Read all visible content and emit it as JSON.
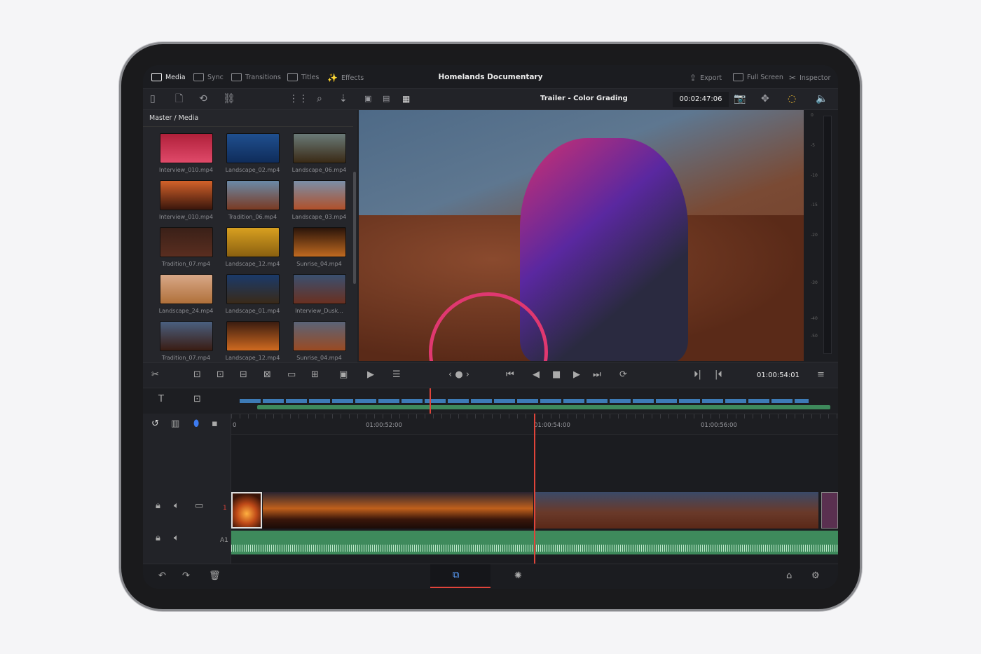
{
  "topbar": {
    "tabs": [
      {
        "label": "Media",
        "icon": "media-icon",
        "active": true
      },
      {
        "label": "Sync",
        "icon": "sync-icon"
      },
      {
        "label": "Transitions",
        "icon": "transitions-icon"
      },
      {
        "label": "Titles",
        "icon": "titles-icon"
      },
      {
        "label": "Effects",
        "icon": "effects-wand-icon"
      }
    ],
    "project_title": "Homelands Documentary",
    "right": [
      {
        "label": "Export",
        "icon": "export-icon"
      },
      {
        "label": "Full Screen",
        "icon": "fullscreen-icon"
      },
      {
        "label": "Inspector",
        "icon": "inspector-icon"
      }
    ]
  },
  "viewer": {
    "timeline_name": "Trailer - Color Grading",
    "source_timecode": "00:02:47:06"
  },
  "media": {
    "breadcrumb": "Master / Media",
    "clips": [
      {
        "name": "Interview_010.mp4",
        "colors": [
          "#b0203a",
          "#e04a6a"
        ]
      },
      {
        "name": "Landscape_02.mp4",
        "colors": [
          "#1f4f8f",
          "#0f2c5a"
        ]
      },
      {
        "name": "Landscape_06.mp4",
        "colors": [
          "#6a7a78",
          "#3a2a15"
        ]
      },
      {
        "name": "Interview_010.mp4",
        "colors": [
          "#d4622a",
          "#3a160c"
        ]
      },
      {
        "name": "Tradition_06.mp4",
        "colors": [
          "#6a8aa8",
          "#7a3a22"
        ]
      },
      {
        "name": "Landscape_03.mp4",
        "colors": [
          "#7a8fa8",
          "#b0502a"
        ]
      },
      {
        "name": "Tradition_07.mp4",
        "colors": [
          "#3a2018",
          "#5a2e20"
        ]
      },
      {
        "name": "Landscape_12.mp4",
        "colors": [
          "#d8a020",
          "#8a6010"
        ]
      },
      {
        "name": "Sunrise_04.mp4",
        "colors": [
          "#2a140a",
          "#c06a20"
        ]
      },
      {
        "name": "Landscape_24.mp4",
        "colors": [
          "#d8a888",
          "#b0703a"
        ]
      },
      {
        "name": "Landscape_01.mp4",
        "colors": [
          "#1a3a6a",
          "#3a2a18"
        ]
      },
      {
        "name": "Interview_Dusk...",
        "colors": [
          "#3a5070",
          "#6a3020"
        ]
      },
      {
        "name": "Tradition_07.mp4",
        "colors": [
          "#4a6080",
          "#3a1c12"
        ]
      },
      {
        "name": "Landscape_12.mp4",
        "colors": [
          "#3a1c10",
          "#d06a20"
        ]
      },
      {
        "name": "Sunrise_04.mp4",
        "colors": [
          "#5a6478",
          "#9a4a22"
        ]
      }
    ]
  },
  "meter": {
    "scale": [
      "0",
      "-5",
      "-10",
      "-15",
      "-20",
      "-30",
      "-40",
      "-50"
    ]
  },
  "transport": {
    "timecode": "01:00:54:01"
  },
  "timeline": {
    "ruler_labels": [
      "0",
      "01:00:52:00",
      "01:00:54:00",
      "01:00:56:00"
    ],
    "video_track": "1",
    "audio_track": "A1"
  },
  "colors": {
    "accent": "#e0443a",
    "clip_blue": "#3d7bb6",
    "audio_green": "#3e8a5c",
    "background": "#1f2024"
  }
}
